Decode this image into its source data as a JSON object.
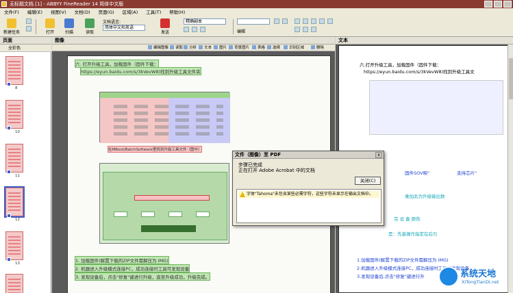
{
  "window": {
    "title": "无标题文档 [1] - ABBYY FineReader 14 简体中文版"
  },
  "menu": [
    "文件(F)",
    "编辑(E)",
    "视图(V)",
    "文档(D)",
    "页面(G)",
    "区域(A)",
    "工具(T)",
    "帮助(H)"
  ],
  "toolbar": {
    "new_task": "新建任务",
    "open": "打开",
    "scan": "扫描",
    "read": "读取",
    "doc_language_label": "文档语言:",
    "doc_language_value": "简体中文和英语",
    "send": "发送",
    "mode_value": "精确副本",
    "edit_label": "编辑"
  },
  "left_pane": {
    "header": "页面",
    "color_label": "全彩色",
    "thumbs": [
      "8",
      "10",
      "11",
      "12",
      "13",
      ""
    ]
  },
  "center_pane": {
    "header": "图像",
    "tools": [
      "编辑图像",
      "读取",
      "分析",
      "文本",
      "图片",
      "背景图片",
      "表格",
      "选择",
      "识别区域",
      "删除"
    ],
    "page": {
      "line1": "六. 打开升级工具，加载固件（固件下载：",
      "line2": "https://eyun.baidu.com/s/3kVevW8)找到升级工具文件夹",
      "caption1": "在MBoot/BatchSoftware里找到升级工具文件（图中）",
      "line3": "1. 加载固件(解置下载的ZIP文件需解压为 IMG)",
      "line4": "2. 机器进入升级模式连接PC，成功连接时工具可发现设备",
      "line5": "3. 发现设备后，点击\"修复\"键进行升级，直至升级成功，升级完成。"
    }
  },
  "dialog": {
    "title": "文件（图像）至 PDF",
    "message1": "步骤已完成",
    "message2": "正在打开 Adobe Acrobat 中的文档",
    "close_button": "关闭(C)",
    "warning": "字体\"Tahoma\"未包含某些必需字符，这些字符未显示在输出文档中。"
  },
  "right_pane": {
    "header": "文本",
    "lines": [
      "六.打开升级工具，加载固件（固件下载：",
      "https://eyun.baidu.com/s/3kVevW8)找到升级工具文",
      "固件SOV映\"",
      "支持芯片\"",
      "乘加此为升级输出数",
      "完    设 备 颜色",
      "  是：先基操作指定在后引",
      "1.加载固件(解置下载的ZIP文件需解压为 IMG)",
      "2.机器进入升级模式连接PC，成功连接时工具可发现设备。",
      "3.发现设备后,点击\"修复\"键进行升"
    ]
  },
  "watermark": {
    "title": "系统天地",
    "url": "XiTongTianDi.net"
  }
}
